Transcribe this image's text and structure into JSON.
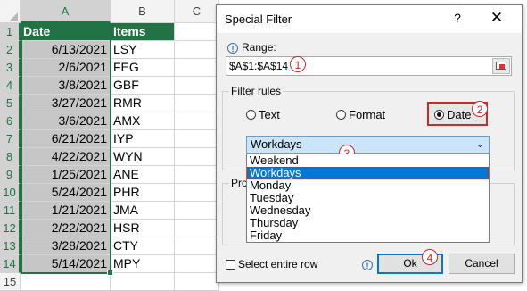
{
  "sheet": {
    "columns": [
      "A",
      "B",
      "C"
    ],
    "rows": [
      {
        "num": "1",
        "a": "Date",
        "b": "Items"
      },
      {
        "num": "2",
        "a": "6/13/2021",
        "b": "LSY"
      },
      {
        "num": "3",
        "a": "2/6/2021",
        "b": "FEG"
      },
      {
        "num": "4",
        "a": "3/8/2021",
        "b": "GBF"
      },
      {
        "num": "5",
        "a": "3/27/2021",
        "b": "RMR"
      },
      {
        "num": "6",
        "a": "3/6/2021",
        "b": "AMX"
      },
      {
        "num": "7",
        "a": "6/21/2021",
        "b": "IYP"
      },
      {
        "num": "8",
        "a": "4/22/2021",
        "b": "WYN"
      },
      {
        "num": "9",
        "a": "1/25/2021",
        "b": "ANE"
      },
      {
        "num": "10",
        "a": "5/24/2021",
        "b": "PHR"
      },
      {
        "num": "11",
        "a": "1/21/2021",
        "b": "JMA"
      },
      {
        "num": "12",
        "a": "2/22/2021",
        "b": "HSR"
      },
      {
        "num": "13",
        "a": "3/28/2021",
        "b": "CTY"
      },
      {
        "num": "14",
        "a": "5/14/2021",
        "b": "MPY"
      },
      {
        "num": "15",
        "a": "",
        "b": ""
      }
    ],
    "header_color": "#217346",
    "selection_color": "#217346"
  },
  "dialog": {
    "title": "Special Filter",
    "help": "?",
    "close": "✕",
    "range_label": "Range:",
    "range_value": "$A$1:$A$14",
    "filter_rules_label": "Filter rules",
    "radio_text": "Text",
    "radio_format": "Format",
    "radio_date": "Date",
    "selected_rule": "Date",
    "combo_value": "Workdays",
    "options": [
      "Weekend",
      "Workdays",
      "Monday",
      "Tuesday",
      "Wednesday",
      "Thursday",
      "Friday"
    ],
    "selected_option": "Workdays",
    "process_label": "Pro",
    "select_entire_row": "Select entire row",
    "ok": "Ok",
    "cancel": "Cancel"
  },
  "badges": [
    "1",
    "2",
    "3",
    "4"
  ],
  "annotation_color": "#cc2a2a"
}
